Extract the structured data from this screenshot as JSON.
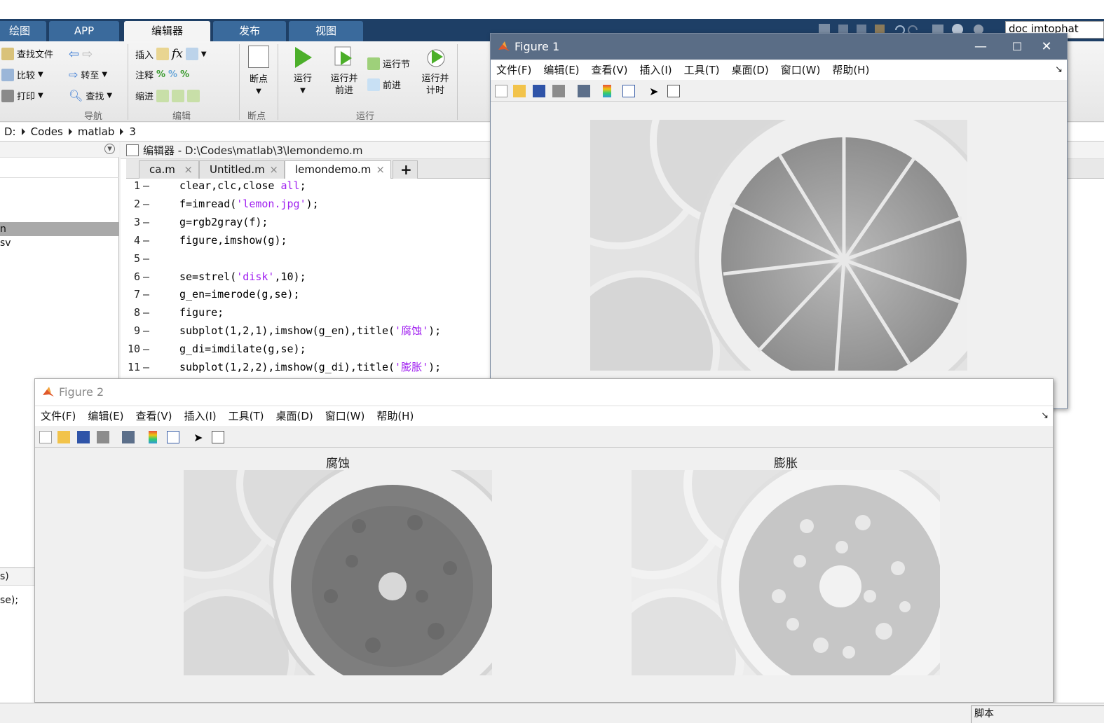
{
  "ribbon_tabs": [
    "绘图",
    "APP",
    "编辑器",
    "发布",
    "视图"
  ],
  "doc_search": {
    "value": "doc imtophat"
  },
  "ribbon": {
    "find_file": "查找文件",
    "compare": "比较",
    "print": "打印",
    "goto": "转至",
    "find": "查找",
    "insert": "插入",
    "comment": "注释",
    "indent": "缩进",
    "breakpoints": "断点",
    "run": "运行",
    "run_advance": [
      "运行并",
      "前进"
    ],
    "run_section": "运行节",
    "advance": "前进",
    "run_time": [
      "运行并",
      "计时"
    ],
    "groups": {
      "nav": "导航",
      "edit": "编辑",
      "breakpoints": "断点",
      "run": "运行"
    }
  },
  "address": {
    "parts": [
      "D:",
      "Codes",
      "matlab",
      "3"
    ]
  },
  "left_panel": {
    "item1": "n",
    "item2": "sv",
    "item3": "s)",
    "item4": "se);"
  },
  "editor": {
    "title": "编辑器 - D:\\Codes\\matlab\\3\\lemondemo.m",
    "tabs": [
      "ca.m",
      "Untitled.m",
      "lemondemo.m"
    ],
    "active_tab": "lemondemo.m",
    "close_glyph": "×",
    "add_tab": "+",
    "lines": [
      {
        "n": "1",
        "pre": "clear,clc,close ",
        "str": "all",
        "post": ";"
      },
      {
        "n": "2",
        "pre": "f=imread(",
        "str": "'lemon.jpg'",
        "post": ");"
      },
      {
        "n": "3",
        "pre": "g=rgb2gray(f);",
        "str": "",
        "post": ""
      },
      {
        "n": "4",
        "pre": "figure,imshow(g);",
        "str": "",
        "post": ""
      },
      {
        "n": "5",
        "pre": "",
        "str": "",
        "post": ""
      },
      {
        "n": "6",
        "pre": "se=strel(",
        "str": "'disk'",
        "post": ",10);"
      },
      {
        "n": "7",
        "pre": "g_en=imerode(g,se);",
        "str": "",
        "post": ""
      },
      {
        "n": "8",
        "pre": "figure;",
        "str": "",
        "post": ""
      },
      {
        "n": "9",
        "pre": "subplot(1,2,1),imshow(g_en),title(",
        "str": "'腐蚀'",
        "post": ");"
      },
      {
        "n": "10",
        "pre": "g_di=imdilate(g,se);",
        "str": "",
        "post": ""
      },
      {
        "n": "11",
        "pre": "subplot(1,2,2),imshow(g_di),title(",
        "str": "'膨胀'",
        "post": ");"
      }
    ]
  },
  "figure1": {
    "title": "Figure 1",
    "menu": [
      "文件(F)",
      "编辑(E)",
      "查看(V)",
      "插入(I)",
      "工具(T)",
      "桌面(D)",
      "窗口(W)",
      "帮助(H)"
    ],
    "dock_glyph": "↘",
    "min": "—",
    "max": "☐",
    "close": "✕"
  },
  "figure2": {
    "title": "Figure 2",
    "menu": [
      "文件(F)",
      "编辑(E)",
      "查看(V)",
      "插入(I)",
      "工具(T)",
      "桌面(D)",
      "窗口(W)",
      "帮助(H)"
    ],
    "dock_glyph": "↘",
    "subplot1_title": "腐蚀",
    "subplot2_title": "膨胀"
  },
  "status": {
    "script": "脚本"
  },
  "colors": {
    "tabbar": "#1e3f66",
    "string": "#a020f0",
    "fig_title_active": "#5a6d86"
  }
}
